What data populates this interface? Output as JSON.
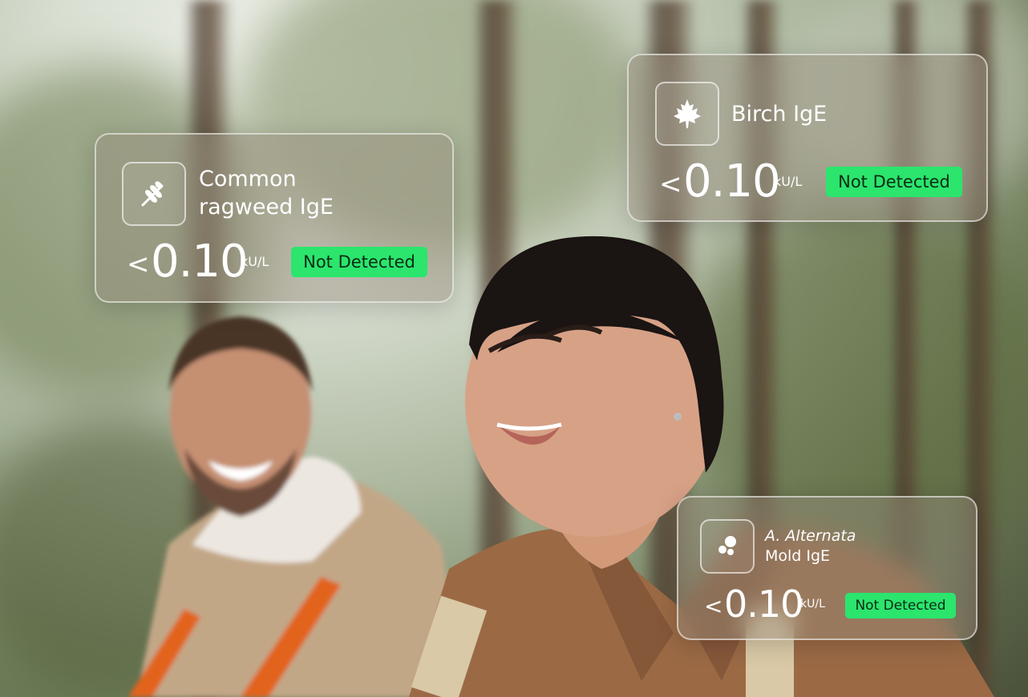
{
  "cards": [
    {
      "icon": "wheat-icon",
      "title_line1": "Common",
      "title_line2": "ragweed IgE",
      "comparator": "<",
      "value": "0.10",
      "unit": "kU/L",
      "status": "Not Detected"
    },
    {
      "icon": "maple-leaf-icon",
      "title_line1": "Birch IgE",
      "comparator": "<",
      "value": "0.10",
      "unit": "kU/L",
      "status": "Not Detected"
    },
    {
      "icon": "mold-spores-icon",
      "title_line1": "A. Alternata",
      "title_line2": "Mold IgE",
      "comparator": "<",
      "value": "0.10",
      "unit": "kU/L",
      "status": "Not Detected"
    }
  ],
  "colors": {
    "status_badge": "#2be56d",
    "status_text": "#0c2b14"
  }
}
